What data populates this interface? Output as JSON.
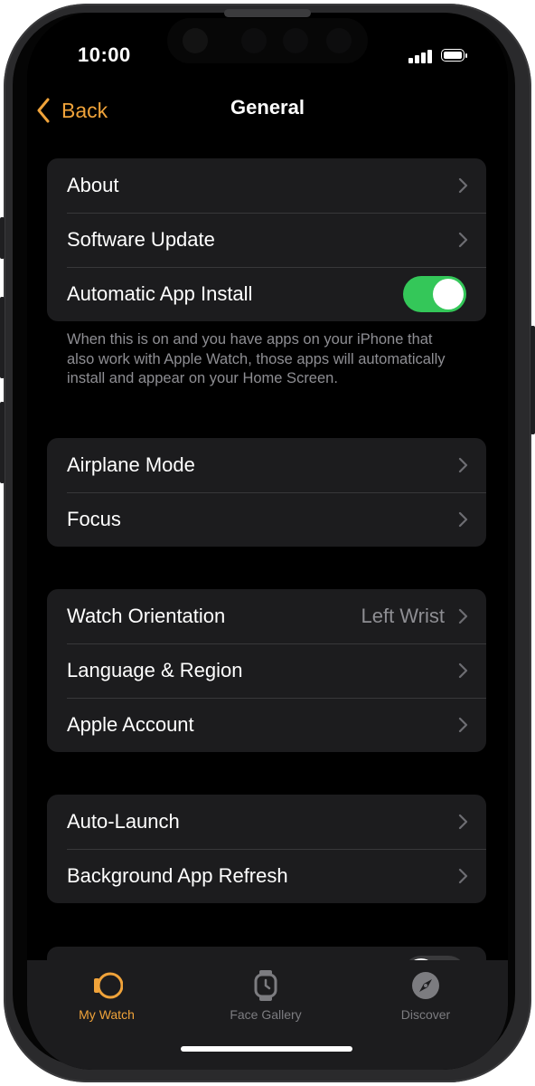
{
  "status_bar": {
    "time": "10:00"
  },
  "nav": {
    "back_label": "Back",
    "title": "General"
  },
  "group1": {
    "rows": [
      {
        "label": "About"
      },
      {
        "label": "Software Update"
      },
      {
        "label": "Automatic App Install"
      }
    ],
    "automatic_app_install_on": true
  },
  "group1_footer": "When this is on and you have apps on your iPhone that also work with Apple Watch, those apps will automatically install and appear on your Home Screen.",
  "group2": {
    "rows": [
      {
        "label": "Airplane Mode"
      },
      {
        "label": "Focus"
      }
    ]
  },
  "group3": {
    "rows": [
      {
        "label": "Watch Orientation",
        "value": "Left Wrist"
      },
      {
        "label": "Language & Region"
      },
      {
        "label": "Apple Account"
      }
    ]
  },
  "group4": {
    "rows": [
      {
        "label": "Auto-Launch"
      },
      {
        "label": "Background App Refresh"
      }
    ]
  },
  "tab_bar": {
    "tabs": [
      {
        "label": "My Watch",
        "icon": "my-watch-icon",
        "active": true
      },
      {
        "label": "Face Gallery",
        "icon": "face-gallery-icon",
        "active": false
      },
      {
        "label": "Discover",
        "icon": "compass-icon",
        "active": false
      }
    ]
  },
  "colors": {
    "accent": "#f0a33a",
    "toggle_on": "#34c759",
    "background": "#000000",
    "cell": "#1c1c1e",
    "secondary_text": "#8e8e93"
  }
}
